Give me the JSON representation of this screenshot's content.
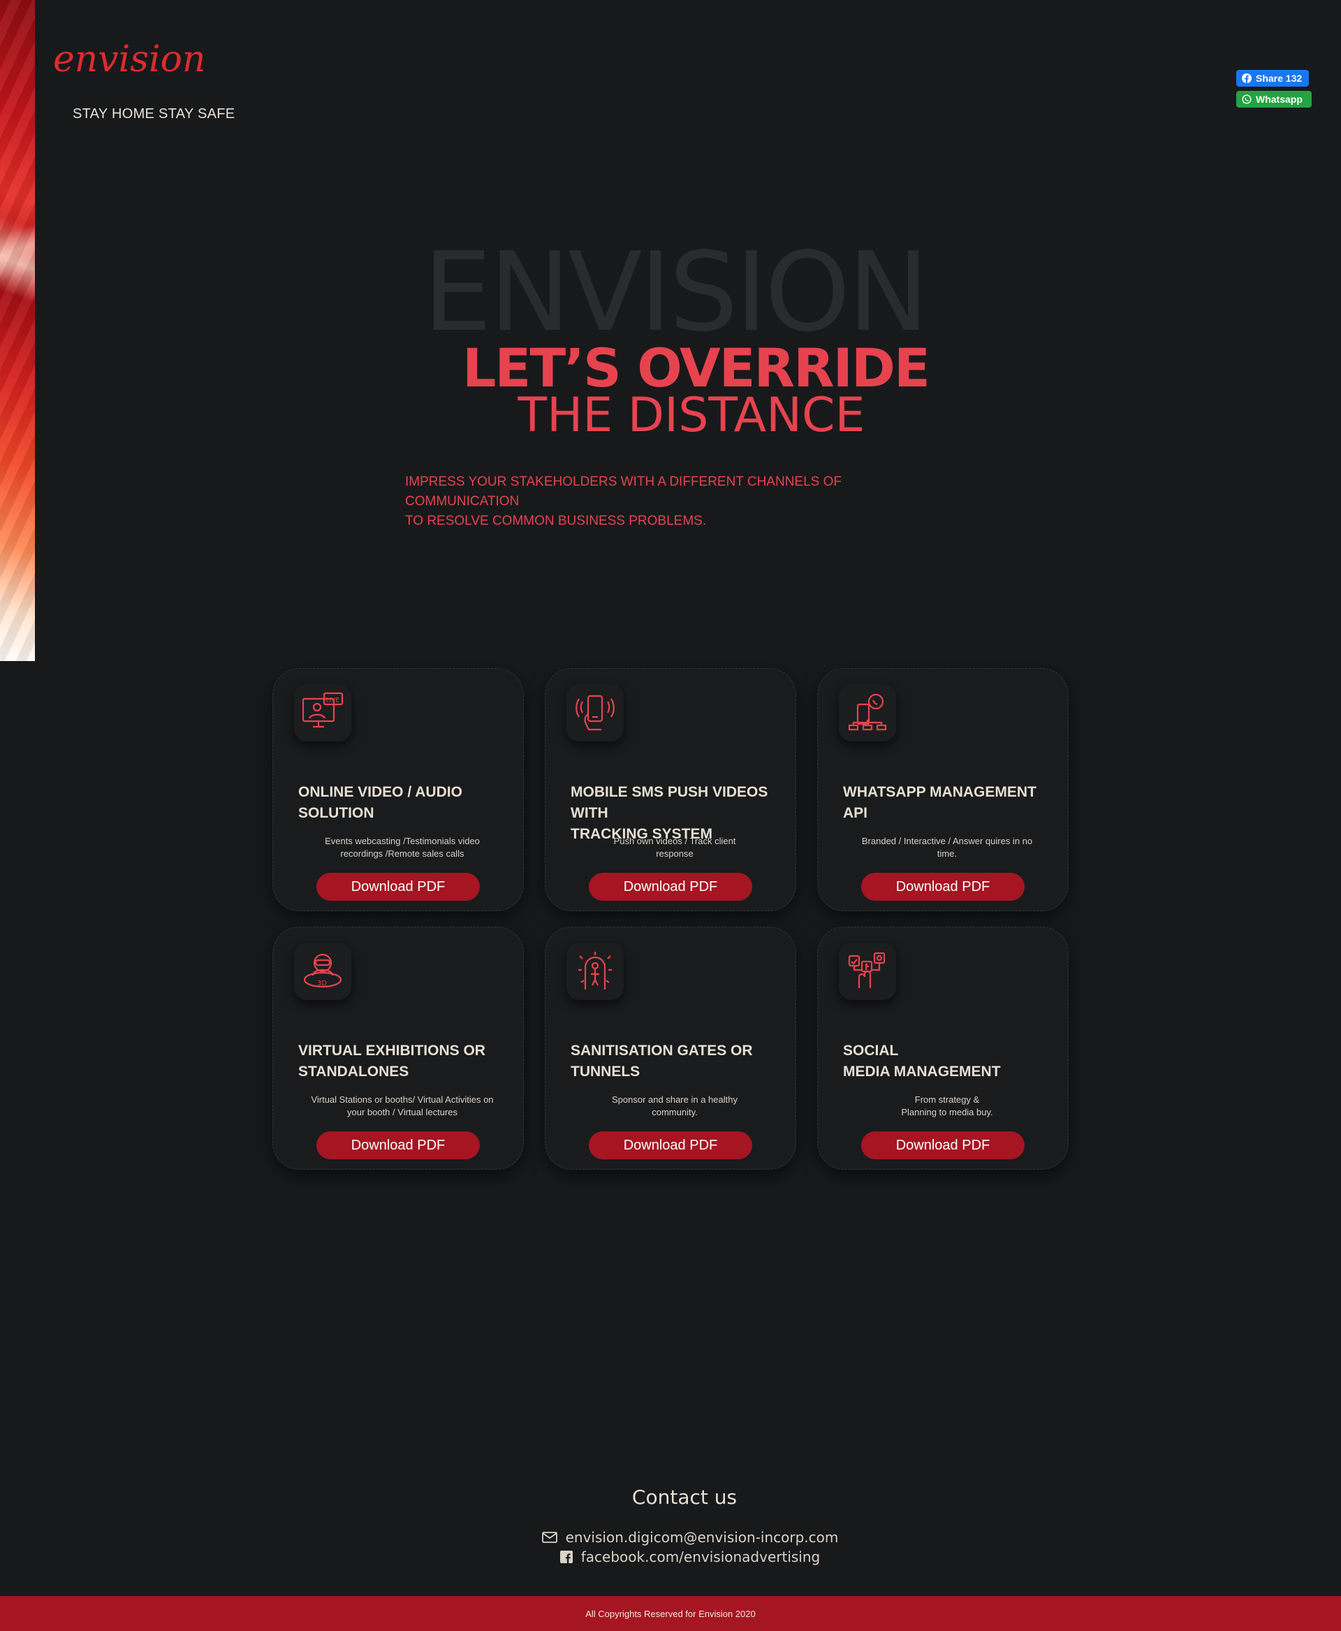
{
  "header": {
    "logo_text": "envision",
    "tagline": "STAY HOME STAY SAFE"
  },
  "share": {
    "facebook_label": "Share 132",
    "whatsapp_label": "Whatsapp",
    "facebook_color": "#1877f2",
    "whatsapp_color": "#25a244"
  },
  "hero": {
    "background_word": "ENVISION",
    "line1": "LET’S OVERRIDE",
    "line2": "THE DISTANCE",
    "subtitle_line1": "IMPRESS YOUR STAKEHOLDERS WITH A DIFFERENT CHANNELS OF COMMUNICATION",
    "subtitle_line2": "TO RESOLVE COMMON BUSINESS PROBLEMS."
  },
  "cards": [
    {
      "icon": "live-video-icon",
      "title": "ONLINE VIDEO / AUDIO\nSOLUTION",
      "description": "Events webcasting /Testimonials video\nrecordings /Remote sales calls",
      "button": "Download PDF"
    },
    {
      "icon": "mobile-push-icon",
      "title": "MOBILE SMS PUSH VIDEOS WITH\nTRACKING SYSTEM",
      "description": "Push own videos / Track client\nresponse",
      "button": "Download PDF"
    },
    {
      "icon": "whatsapp-api-icon",
      "title": "WHATSAPP MANAGEMENT\nAPI",
      "description": "Branded / Interactive / Answer quires in no\ntime.",
      "button": "Download PDF"
    },
    {
      "icon": "virtual-3d-icon",
      "title": "VIRTUAL EXHIBITIONS OR\nSTANDALONES",
      "description": "Virtual Stations or booths/ Virtual Activities on\nyour booth / Virtual lectures",
      "button": "Download PDF"
    },
    {
      "icon": "sanitisation-gate-icon",
      "title": "SANITISATION GATES OR\nTUNNELS",
      "description": "Sponsor and share in a healthy\ncommunity.",
      "button": "Download PDF"
    },
    {
      "icon": "social-media-icon",
      "title": "SOCIAL\nMEDIA MANAGEMENT",
      "description": "From strategy &\nPlanning to media buy.",
      "button": "Download PDF"
    }
  ],
  "contact": {
    "title": "Contact us",
    "email": "envision.digicom@envision-incorp.com",
    "facebook": "facebook.com/envisionadvertising"
  },
  "footer": {
    "copyright": "All Copyrights Reserved for Envision 2020"
  },
  "colors": {
    "background": "#18191b",
    "accent_red": "#e6434f",
    "button_red": "#a51522"
  }
}
